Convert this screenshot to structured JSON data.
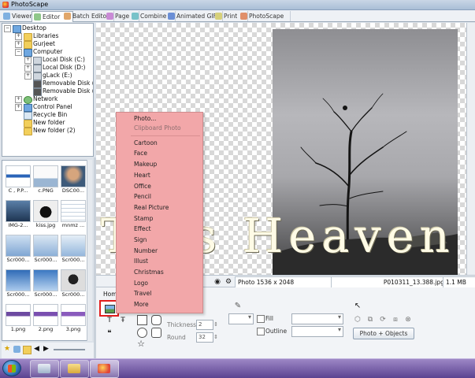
{
  "window": {
    "title": "PhotoScape"
  },
  "tabs": [
    {
      "label": "Viewer"
    },
    {
      "label": "Editor"
    },
    {
      "label": "Batch Editor"
    },
    {
      "label": "Page"
    },
    {
      "label": "Combine"
    },
    {
      "label": "Animated GIF"
    },
    {
      "label": "Print"
    },
    {
      "label": "PhotoScape"
    }
  ],
  "tree": {
    "items": [
      {
        "label": "Desktop",
        "icon": "desktop-icon"
      },
      {
        "label": "Libraries",
        "icon": "folder-icon"
      },
      {
        "label": "Gurjeet",
        "icon": "folder-icon"
      },
      {
        "label": "Computer",
        "icon": "computer-icon"
      },
      {
        "label": "Local Disk (C:)",
        "icon": "drive-icon"
      },
      {
        "label": "Local Disk (D:)",
        "icon": "drive-icon"
      },
      {
        "label": "gLack (E:)",
        "icon": "drive-icon"
      },
      {
        "label": "Removable Disk (G",
        "icon": "removable-drive-icon"
      },
      {
        "label": "Removable Disk (H",
        "icon": "removable-drive-icon"
      },
      {
        "label": "Network",
        "icon": "network-icon"
      },
      {
        "label": "Control Panel",
        "icon": "control-panel-icon"
      },
      {
        "label": "Recycle Bin",
        "icon": "recycle-bin-icon"
      },
      {
        "label": "New folder",
        "icon": "folder-icon"
      },
      {
        "label": "New folder (2)",
        "icon": "folder-icon"
      }
    ]
  },
  "thumbnails": [
    {
      "caption": "C , P.P..."
    },
    {
      "caption": "c.PNG"
    },
    {
      "caption": "DSC00..."
    },
    {
      "caption": "IMG-2..."
    },
    {
      "caption": "kiss.jpg"
    },
    {
      "caption": "mnmz ..."
    },
    {
      "caption": "Scr000..."
    },
    {
      "caption": "Scr000..."
    },
    {
      "caption": "Scr000..."
    },
    {
      "caption": "Scr000..."
    },
    {
      "caption": "Scr000..."
    },
    {
      "caption": "Scr000..."
    },
    {
      "caption": "1.png"
    },
    {
      "caption": "2.png"
    },
    {
      "caption": "3.png"
    }
  ],
  "watermark": {
    "text": "Tips Heaven"
  },
  "status": {
    "photo_info": "Photo 1536 x 2048",
    "filename": "P010311_13.388.jpg",
    "filesize": "1.1 MB"
  },
  "bottom_panel": {
    "home_tab": "Hom",
    "thickness_label": "Thickness",
    "thickness_value": "2",
    "round_label": "Round",
    "round_value": "32",
    "fill_label": "Fill",
    "outline_label": "Outline",
    "photo_objects_button": "Photo + Objects"
  },
  "context_menu": {
    "items": [
      {
        "label": "Photo...",
        "enabled": true
      },
      {
        "label": "Clipboard Photo",
        "enabled": false
      },
      {
        "label": "Cartoon",
        "enabled": true
      },
      {
        "label": "Face",
        "enabled": true
      },
      {
        "label": "Makeup",
        "enabled": true
      },
      {
        "label": "Heart",
        "enabled": true
      },
      {
        "label": "Office",
        "enabled": true
      },
      {
        "label": "Pencil",
        "enabled": true
      },
      {
        "label": "Real Picture",
        "enabled": true
      },
      {
        "label": "Stamp",
        "enabled": true
      },
      {
        "label": "Effect",
        "enabled": true
      },
      {
        "label": "Sign",
        "enabled": true
      },
      {
        "label": "Number",
        "enabled": true
      },
      {
        "label": "Illust",
        "enabled": true
      },
      {
        "label": "Christmas",
        "enabled": true
      },
      {
        "label": "Logo",
        "enabled": true
      },
      {
        "label": "Travel",
        "enabled": true
      },
      {
        "label": "More",
        "enabled": true
      }
    ]
  },
  "colors": {
    "menu_background": "#f2a7a9",
    "highlight_border": "#e21d1d",
    "taskbar": "#5b4391"
  }
}
